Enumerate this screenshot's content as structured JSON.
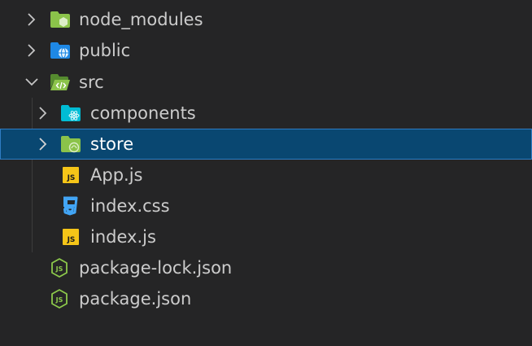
{
  "explorer": {
    "items": [
      {
        "label": "node_modules",
        "kind": "folder",
        "state": "collapsed",
        "icon": "node-modules-folder-icon"
      },
      {
        "label": "public",
        "kind": "folder",
        "state": "collapsed",
        "icon": "public-folder-icon"
      },
      {
        "label": "src",
        "kind": "folder",
        "state": "expanded",
        "icon": "src-folder-icon"
      },
      {
        "label": "components",
        "kind": "folder",
        "state": "collapsed",
        "icon": "components-folder-icon"
      },
      {
        "label": "store",
        "kind": "folder",
        "state": "collapsed",
        "icon": "store-folder-icon",
        "selected": true
      },
      {
        "label": "App.js",
        "kind": "file",
        "icon": "javascript-file-icon"
      },
      {
        "label": "index.css",
        "kind": "file",
        "icon": "css-file-icon"
      },
      {
        "label": "index.js",
        "kind": "file",
        "icon": "javascript-file-icon"
      },
      {
        "label": "package-lock.json",
        "kind": "file",
        "icon": "nodejs-file-icon"
      },
      {
        "label": "package.json",
        "kind": "file",
        "icon": "nodejs-file-icon"
      }
    ]
  },
  "colors": {
    "background": "#252526",
    "selection": "#094771",
    "selection_border": "#2f7cc3",
    "text": "#cccccc",
    "folder_green": "#8bc34a",
    "folder_blue": "#1e88e5",
    "folder_cyan": "#00bcd4",
    "js_yellow": "#f5c518",
    "css_blue": "#42a5f5",
    "node_green": "#8cc84b"
  }
}
